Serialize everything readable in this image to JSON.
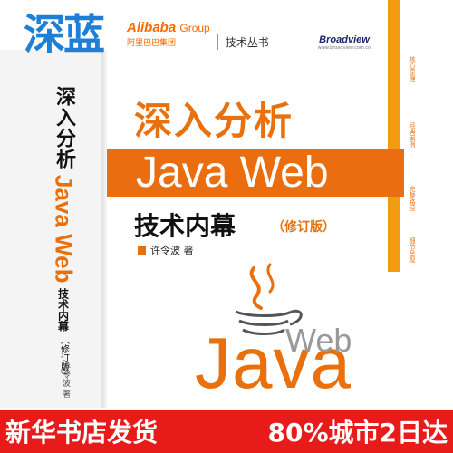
{
  "store": {
    "logo_text": "深蓝"
  },
  "colors": {
    "accent": "#e8710e",
    "banner_red": "#e81a1a",
    "logo_blue": "#1e7fd6",
    "bar_orange": "#f39c12"
  },
  "brand": {
    "alibaba": "Alibaba",
    "group": "Group",
    "alibaba_cn": "阿里巴巴集团",
    "series": "技术丛书"
  },
  "publisher": {
    "name": "Broadview",
    "url": "www.broadview.com.cn"
  },
  "side_tags": [
    "核心原理",
    "经典案例",
    "完整路径",
    "细节呈现"
  ],
  "cover": {
    "title_cn": "深入分析",
    "title_en": "Java Web",
    "subtitle": "技术内幕",
    "edition": "（修订版）",
    "author": "许令波 著",
    "java_word": "Java",
    "web_word": "Web"
  },
  "spine": {
    "title": "深入分析",
    "title_en": "Java Web",
    "subtitle": "技术内幕",
    "edition": "（修订版）",
    "author": "许令波 著"
  },
  "banner": {
    "left": "新华书店发货",
    "right": "80%城市2日达"
  }
}
